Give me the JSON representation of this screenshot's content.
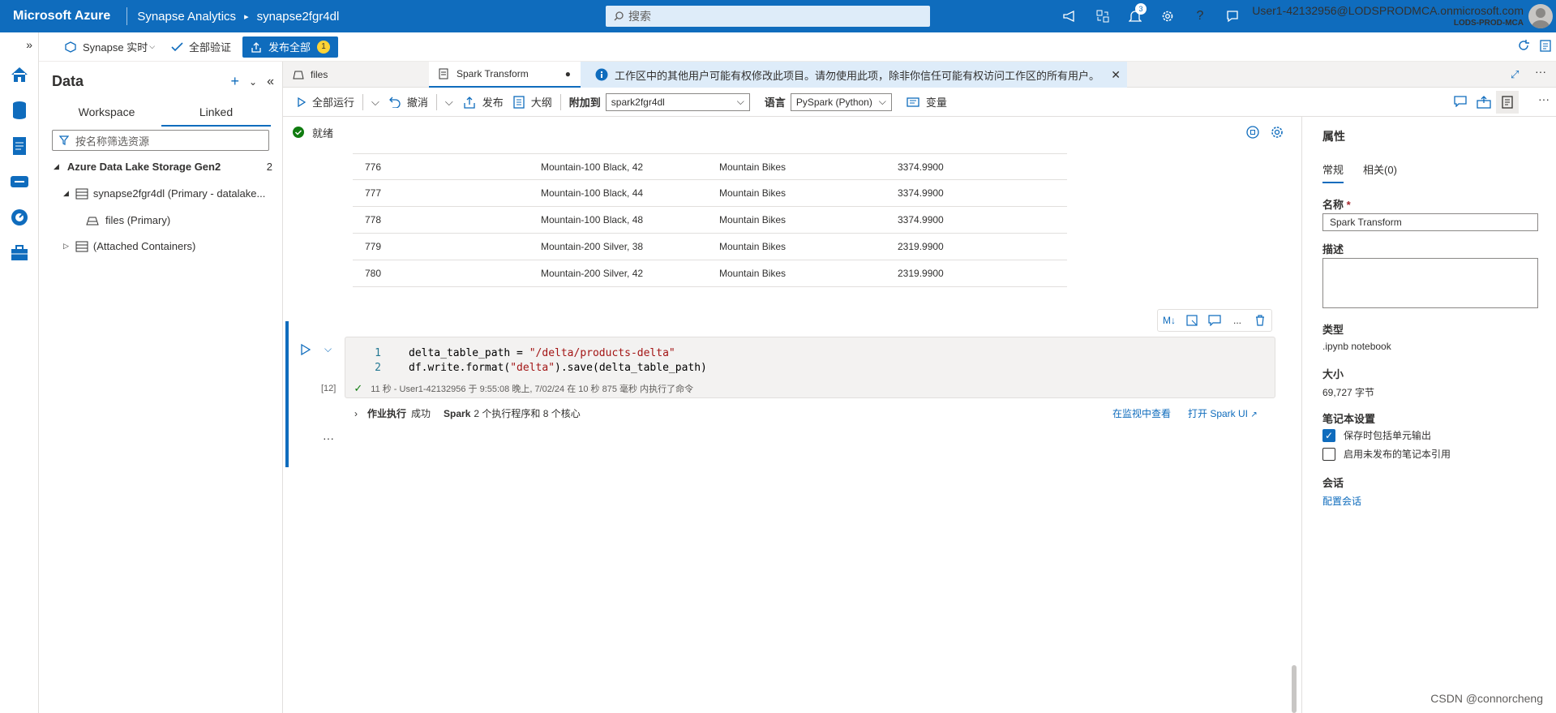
{
  "topbar": {
    "brand": "Microsoft Azure",
    "service": "Synapse Analytics",
    "workspace": "synapse2fgr4dl",
    "search_placeholder": "搜索",
    "notification_count": "3",
    "user_email": "User1-42132956@LODSPRODMCA.onmicrosoft.com",
    "user_tenant": "LODS-PROD-MCA"
  },
  "subbar": {
    "synapse_live": "Synapse 实时",
    "validate_all": "全部验证",
    "publish_all": "发布全部",
    "publish_count": "1"
  },
  "data_panel": {
    "title": "Data",
    "tabs": [
      "Workspace",
      "Linked"
    ],
    "active_tab": "Linked",
    "filter_placeholder": "按名称筛选资源",
    "tree": {
      "root_label": "Azure Data Lake Storage Gen2",
      "root_count": "2",
      "account_label": "synapse2fgr4dl (Primary - datalake...",
      "files_label": "files (Primary)",
      "attached_label": "(Attached Containers)"
    }
  },
  "doc_tabs": [
    "files",
    "Spark Transform"
  ],
  "info_message": "工作区中的其他用户可能有权修改此项目。请勿使用此项，除非你信任可能有权访问工作区的所有用户。",
  "notebook_toolbar": {
    "run_all": "全部运行",
    "undo": "撤消",
    "publish": "发布",
    "outline": "大纲",
    "attach_to_label": "附加到",
    "attach_to_value": "spark2fgr4dl",
    "language_label": "语言",
    "language_value": "PySpark (Python)",
    "variables": "变量"
  },
  "status": "就绪",
  "output_rows": [
    [
      "776",
      "Mountain-100 Black, 42",
      "Mountain Bikes",
      "3374.9900"
    ],
    [
      "777",
      "Mountain-100 Black, 44",
      "Mountain Bikes",
      "3374.9900"
    ],
    [
      "778",
      "Mountain-100 Black, 48",
      "Mountain Bikes",
      "3374.9900"
    ],
    [
      "779",
      "Mountain-200 Silver, 38",
      "Mountain Bikes",
      "2319.9900"
    ],
    [
      "780",
      "Mountain-200 Silver, 42",
      "Mountain Bikes",
      "2319.9900"
    ]
  ],
  "cell": {
    "line1_num": "1",
    "line1_a": "delta_table_path = ",
    "line1_str": "\"/delta/products-delta\"",
    "line2_num": "2",
    "line2_a": "df.write.format(",
    "line2_str": "\"delta\"",
    "line2_b": ").save(delta_table_path)",
    "exec_count": "[12]",
    "exec_meta": "11 秒 - User1-42132956 于 9:55:08 晚上, 7/02/24 在 10 秒 875 毫秒 内执行了命令",
    "job_label": "作业执行",
    "job_status": "成功",
    "job_spark": "Spark",
    "job_detail": "2 个执行程序和 8 个核心",
    "view_in_monitor": "在监视中查看",
    "open_spark_ui": "打开 Spark UI",
    "ml_label": "M↓",
    "more": "..."
  },
  "properties": {
    "title": "属性",
    "tab_general": "常规",
    "tab_related": "相关(0)",
    "name_label": "名称",
    "name_value": "Spark Transform",
    "desc_label": "描述",
    "type_label": "类型",
    "type_value": ".ipynb notebook",
    "size_label": "大小",
    "size_value": "69,727 字节",
    "settings_label": "笔记本设置",
    "include_output": "保存时包括单元输出",
    "enable_unpublished": "启用未发布的笔记本引用",
    "session_label": "会话",
    "configure_session": "配置会话"
  },
  "watermark": "CSDN @connorcheng",
  "colors": {
    "accent": "#0f6cbd",
    "success": "#107c10"
  }
}
